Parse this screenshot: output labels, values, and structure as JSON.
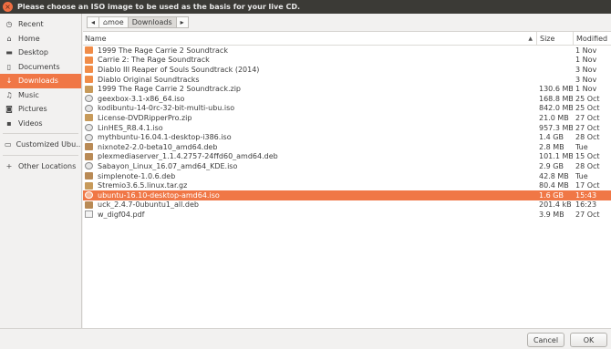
{
  "window": {
    "title": "Please choose an ISO image to be used as the basis for your live CD."
  },
  "sidebar": {
    "items": [
      {
        "label": "Recent",
        "icon": "clock-icon",
        "glyph": "◷"
      },
      {
        "label": "Home",
        "icon": "home-icon",
        "glyph": "⌂"
      },
      {
        "label": "Desktop",
        "icon": "folder-icon",
        "glyph": "▬"
      },
      {
        "label": "Documents",
        "icon": "document-icon",
        "glyph": "▯"
      },
      {
        "label": "Downloads",
        "icon": "download-icon",
        "glyph": "↓",
        "active": true
      },
      {
        "label": "Music",
        "icon": "music-icon",
        "glyph": "♫"
      },
      {
        "label": "Pictures",
        "icon": "camera-icon",
        "glyph": "◙"
      },
      {
        "label": "Videos",
        "icon": "video-icon",
        "glyph": "▪"
      }
    ],
    "extra": [
      {
        "label": "Customized Ubu...",
        "icon": "drive-icon",
        "glyph": "▭"
      },
      {
        "label": "Other Locations",
        "icon": "plus-icon",
        "glyph": "+"
      }
    ]
  },
  "pathbar": {
    "back_glyph": "◂",
    "home_glyph": "⌂",
    "home_label": "moe",
    "current": "Downloads",
    "forward_glyph": "▸"
  },
  "table": {
    "headers": {
      "name": "Name",
      "sort_glyph": "▲",
      "size": "Size",
      "modified": "Modified"
    },
    "rows": [
      {
        "name": "1999 The Rage Carrie 2 Soundtrack",
        "size": "",
        "modified": "1 Nov",
        "type": "folder"
      },
      {
        "name": "Carrie 2: The Rage Soundtrack",
        "size": "",
        "modified": "1 Nov",
        "type": "folder"
      },
      {
        "name": "Diablo III Reaper of Souls Soundtrack (2014)",
        "size": "",
        "modified": "3 Nov",
        "type": "folder"
      },
      {
        "name": "Diablo Original Soundtracks",
        "size": "",
        "modified": "3 Nov",
        "type": "folder"
      },
      {
        "name": "1999 The Rage Carrie 2 Soundtrack.zip",
        "size": "130.6 MB",
        "modified": "1 Nov",
        "type": "archive"
      },
      {
        "name": "geexbox-3.1-x86_64.iso",
        "size": "168.8 MB",
        "modified": "25 Oct",
        "type": "disc"
      },
      {
        "name": "kodibuntu-14-0rc-32-bit-multi-ubu.iso",
        "size": "842.0 MB",
        "modified": "25 Oct",
        "type": "disc"
      },
      {
        "name": "License-DVDRipperPro.zip",
        "size": "21.0 MB",
        "modified": "27 Oct",
        "type": "archive"
      },
      {
        "name": "LinHES_R8.4.1.iso",
        "size": "957.3 MB",
        "modified": "27 Oct",
        "type": "disc"
      },
      {
        "name": "mythbuntu-16.04.1-desktop-i386.iso",
        "size": "1.4 GB",
        "modified": "28 Oct",
        "type": "disc"
      },
      {
        "name": "nixnote2-2.0-beta10_amd64.deb",
        "size": "2.8 MB",
        "modified": "Tue",
        "type": "pkg"
      },
      {
        "name": "plexmediaserver_1.1.4.2757-24ffd60_amd64.deb",
        "size": "101.1 MB",
        "modified": "15 Oct",
        "type": "pkg"
      },
      {
        "name": "Sabayon_Linux_16.07_amd64_KDE.iso",
        "size": "2.9 GB",
        "modified": "28 Oct",
        "type": "disc"
      },
      {
        "name": "simplenote-1.0.6.deb",
        "size": "42.8 MB",
        "modified": "Tue",
        "type": "pkg"
      },
      {
        "name": "Stremio3.6.5.linux.tar.gz",
        "size": "80.4 MB",
        "modified": "17 Oct",
        "type": "archive"
      },
      {
        "name": "ubuntu-16.10-desktop-amd64.iso",
        "size": "1.6 GB",
        "modified": "15:43",
        "type": "disc",
        "selected": true
      },
      {
        "name": "uck_2.4.7-0ubuntu1_all.deb",
        "size": "201.4 kB",
        "modified": "16:23",
        "type": "pkg"
      },
      {
        "name": "w_digf04.pdf",
        "size": "3.9 MB",
        "modified": "27 Oct",
        "type": "pdf"
      }
    ]
  },
  "buttons": {
    "cancel": "Cancel",
    "ok": "OK"
  },
  "colors": {
    "accent": "#f07746",
    "titlebar": "#3b3a36",
    "close": "#f06e42"
  }
}
